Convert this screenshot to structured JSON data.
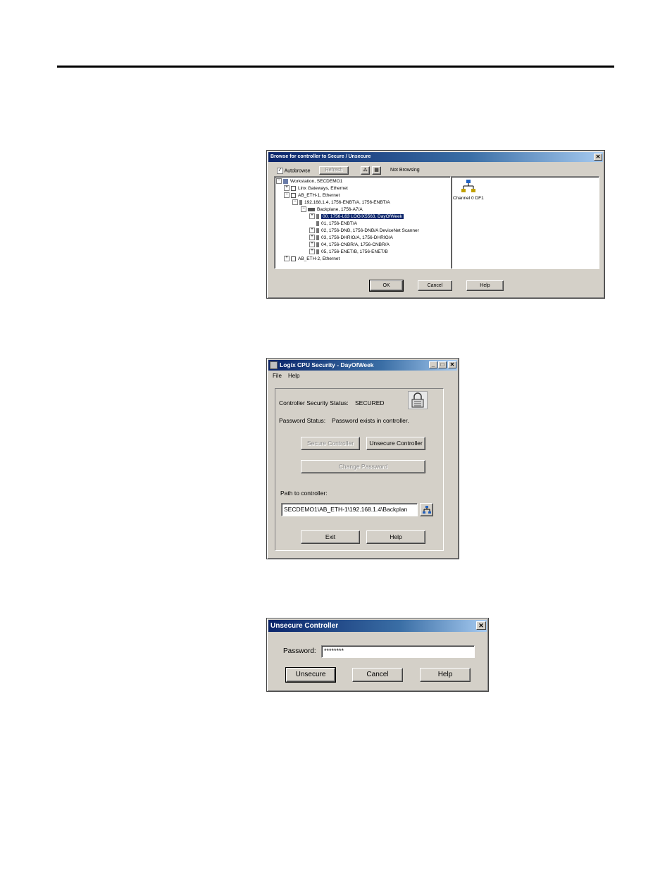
{
  "browse_dialog": {
    "title": "Browse for controller to Secure / Unsecure",
    "close_glyph": "✕",
    "autobrowse_label": "Autobrowse",
    "autobrowse_checked": true,
    "refresh_label": "Refresh",
    "status_text": "Not Browsing",
    "tree": [
      {
        "label": "Workstation, SECDEMO1",
        "expander": "-",
        "icon": "workstation-icon"
      },
      {
        "label": "Linx Gateways, Ethernet",
        "expander": "+",
        "icon": "network-icon"
      },
      {
        "label": "AB_ETH-1, Ethernet",
        "expander": "-",
        "icon": "network-icon"
      },
      {
        "label": "192.168.1.4, 1756-ENBT/A, 1756-ENBT/A",
        "expander": "-",
        "icon": "module-icon"
      },
      {
        "label": "Backplane, 1756-A7/A",
        "expander": "-",
        "icon": "backplane-icon"
      },
      {
        "label": "00, 1756-L63 LOGIX5563, DayOfWeek",
        "expander": "+",
        "icon": "module-icon",
        "selected": true
      },
      {
        "label": "01, 1756-ENBT/A",
        "expander": "",
        "icon": "module-icon"
      },
      {
        "label": "02, 1756-DNB, 1756-DNB/A DeviceNet Scanner",
        "expander": "+",
        "icon": "module-icon"
      },
      {
        "label": "03, 1756-DHRIO/A,  1756-DHRIO/A",
        "expander": "+",
        "icon": "module-icon"
      },
      {
        "label": "04, 1756-CNBR/A, 1756-CNBR/A",
        "expander": "+",
        "icon": "module-icon"
      },
      {
        "label": "05, 1756-ENET/B, 1756-ENET/B",
        "expander": "+",
        "icon": "module-icon"
      },
      {
        "label": "AB_ETH-2, Ethernet",
        "expander": "+",
        "icon": "network-icon"
      }
    ],
    "right_pane_item": "Channel 0 DF1",
    "ok_label": "OK",
    "cancel_label": "Cancel",
    "help_label": "Help"
  },
  "security_dialog": {
    "title": "Logix CPU Security - DayOfWeek",
    "minimize_glyph": "_",
    "maximize_glyph": "□",
    "close_glyph": "✕",
    "menu": [
      "File",
      "Help"
    ],
    "security_status_label": "Controller Security Status:",
    "security_status_value": "SECURED",
    "password_status_label": "Password Status:",
    "password_status_value": "Password exists in controller.",
    "secure_label": "Secure Controller",
    "unsecure_label": "Unsecure Controller",
    "change_password_label": "Change Password",
    "path_label": "Path to controller:",
    "path_value": "SECDEMO1\\AB_ETH-1\\192.168.1.4\\Backplan",
    "exit_label": "Exit",
    "help_label": "Help"
  },
  "unsecure_dialog": {
    "title": "Unsecure Controller",
    "close_glyph": "✕",
    "password_label": "Password:",
    "password_value": "********",
    "unsecure_label": "Unsecure",
    "cancel_label": "Cancel",
    "help_label": "Help"
  }
}
